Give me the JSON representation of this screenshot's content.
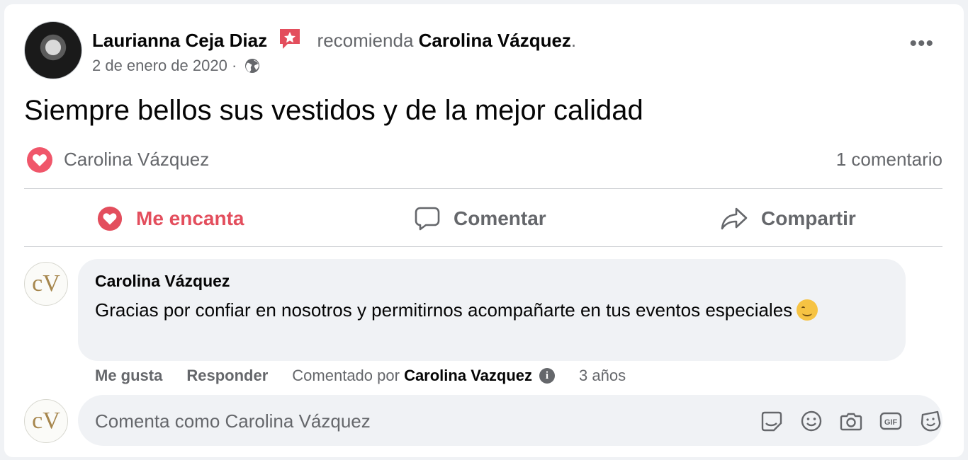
{
  "post": {
    "author": "Laurianna Ceja Diaz",
    "recommends": "recomienda",
    "page": "Carolina Vázquez",
    "period": ".",
    "date": "2 de enero de 2020",
    "separator": " · ",
    "text": "Siempre bellos sus vestidos y de la mejor calidad",
    "more": "•••"
  },
  "reactions": {
    "by": "Carolina Vázquez",
    "comments_count": "1 comentario"
  },
  "actions": {
    "love": "Me encanta",
    "comment": "Comentar",
    "share": "Compartir"
  },
  "comment": {
    "avatar_monogram": "cV",
    "author": "Carolina Vázquez",
    "text": "Gracias por confiar en nosotros y permitirnos acompañarte en tus eventos especiales",
    "like": "Me gusta",
    "reply": "Responder",
    "commented_by_label": "Comentado por",
    "commented_by": "Carolina Vazquez",
    "time": "3 años"
  },
  "composer": {
    "placeholder": "Comenta como Carolina Vázquez",
    "icons": [
      "sticker-icon",
      "emoji-icon",
      "camera-icon",
      "gif-icon",
      "avatar-sticker-icon"
    ]
  },
  "colors": {
    "love_red": "#e34e5d",
    "secondary_text": "#65676b",
    "bubble_bg": "#f0f2f5",
    "gold": "#a6864d"
  }
}
